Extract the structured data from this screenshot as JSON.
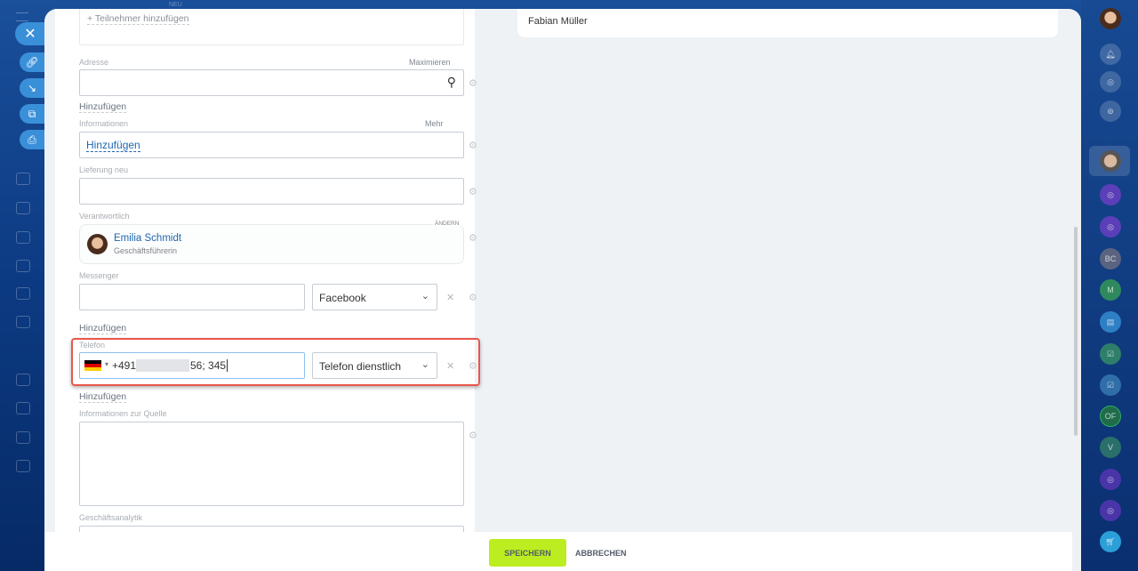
{
  "participants": {
    "add_label": "+ Teilnehmer hinzufügen"
  },
  "address": {
    "label": "Adresse",
    "maximize": "Maximieren",
    "add": "Hinzufügen"
  },
  "info": {
    "label": "Informationen",
    "more": "Mehr",
    "value": "Hinzufügen"
  },
  "delivery": {
    "label": "Lieferung neu"
  },
  "responsible": {
    "label": "Verantwortlich",
    "change": "ÄNDERN",
    "name": "Emilia Schmidt",
    "role": "Geschäftsführerin"
  },
  "messenger": {
    "label": "Messenger",
    "value": "",
    "type": "Facebook",
    "add": "Hinzufügen"
  },
  "phone": {
    "label": "Telefon",
    "prefix": "+491",
    "suffix": "56; 345",
    "type": "Telefon dienstlich",
    "add": "Hinzufügen",
    "highlight_color": "#e8574d"
  },
  "source_info": {
    "label": "Informationen zur Quelle"
  },
  "analytics": {
    "label": "Geschäftsanalytik"
  },
  "right": {
    "contact_name": "Fabian Müller"
  },
  "footer": {
    "save": "SPEICHERN",
    "cancel": "ABBRECHEN"
  },
  "rail": {
    "items": [
      "BC",
      "M",
      "OF",
      "V"
    ]
  },
  "top": {
    "new_badge": "NEU"
  }
}
